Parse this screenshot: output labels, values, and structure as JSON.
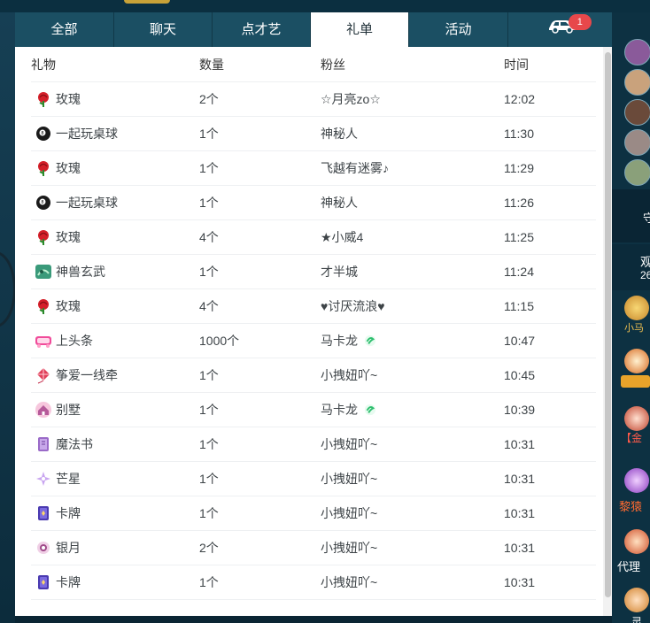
{
  "tabs": [
    {
      "label": "全部"
    },
    {
      "label": "聊天"
    },
    {
      "label": "点才艺"
    },
    {
      "label": "礼单"
    },
    {
      "label": "活动"
    },
    {
      "label": "",
      "icon": "car-icon",
      "badge": "1"
    }
  ],
  "active_tab": "礼单",
  "table": {
    "headers": [
      "礼物",
      "数量",
      "粉丝",
      "时间"
    ],
    "rows": [
      {
        "icon": "rose-icon",
        "gift": "玫瑰",
        "qty": "2个",
        "fan": "☆月亮zo☆",
        "time": "12:02"
      },
      {
        "icon": "billiard-ball-icon",
        "gift": "一起玩桌球",
        "qty": "1个",
        "fan": "神秘人",
        "time": "11:30"
      },
      {
        "icon": "rose-icon",
        "gift": "玫瑰",
        "qty": "1个",
        "fan": "飞越有迷雾♪",
        "time": "11:29"
      },
      {
        "icon": "billiard-ball-icon",
        "gift": "一起玩桌球",
        "qty": "1个",
        "fan": "神秘人",
        "time": "11:26"
      },
      {
        "icon": "rose-icon",
        "gift": "玫瑰",
        "qty": "4个",
        "fan": "★小威4",
        "time": "11:25"
      },
      {
        "icon": "turtle-beast-icon",
        "gift": "神兽玄武",
        "qty": "1个",
        "fan": "才半城",
        "time": "11:24"
      },
      {
        "icon": "rose-icon",
        "gift": "玫瑰",
        "qty": "4个",
        "fan": "♥讨厌流浪♥",
        "time": "11:15"
      },
      {
        "icon": "headline-icon",
        "gift": "上头条",
        "qty": "1000个",
        "fan": "马卡龙",
        "fan_badge": "green-badge-icon",
        "time": "10:47"
      },
      {
        "icon": "kite-icon",
        "gift": "筝爱一线牵",
        "qty": "1个",
        "fan": "小拽妞吖~",
        "time": "10:45"
      },
      {
        "icon": "villa-icon",
        "gift": "别墅",
        "qty": "1个",
        "fan": "马卡龙",
        "fan_badge": "green-badge-icon",
        "time": "10:39"
      },
      {
        "icon": "magic-book-icon",
        "gift": "魔法书",
        "qty": "1个",
        "fan": "小拽妞吖~",
        "time": "10:31"
      },
      {
        "icon": "star-icon",
        "gift": "芒星",
        "qty": "1个",
        "fan": "小拽妞吖~",
        "time": "10:31"
      },
      {
        "icon": "card-icon",
        "gift": "卡牌",
        "qty": "1个",
        "fan": "小拽妞吖~",
        "time": "10:31"
      },
      {
        "icon": "silver-moon-icon",
        "gift": "银月",
        "qty": "2个",
        "fan": "小拽妞吖~",
        "time": "10:31"
      },
      {
        "icon": "card-icon",
        "gift": "卡牌",
        "qty": "1个",
        "fan": "小拽妞吖~",
        "time": "10:31"
      }
    ]
  },
  "right_panel": {
    "viewer_label": "观",
    "viewer_count": "26",
    "guard_label": "守",
    "rank_labels": [
      "小马",
      "【金",
      "黎猿",
      "代理",
      "灵"
    ]
  },
  "colors": {
    "tab_bar": "#1b4f63",
    "active_tab": "#ffffff",
    "badge": "#e7484b",
    "fan_badge": "#2fbf6f"
  }
}
